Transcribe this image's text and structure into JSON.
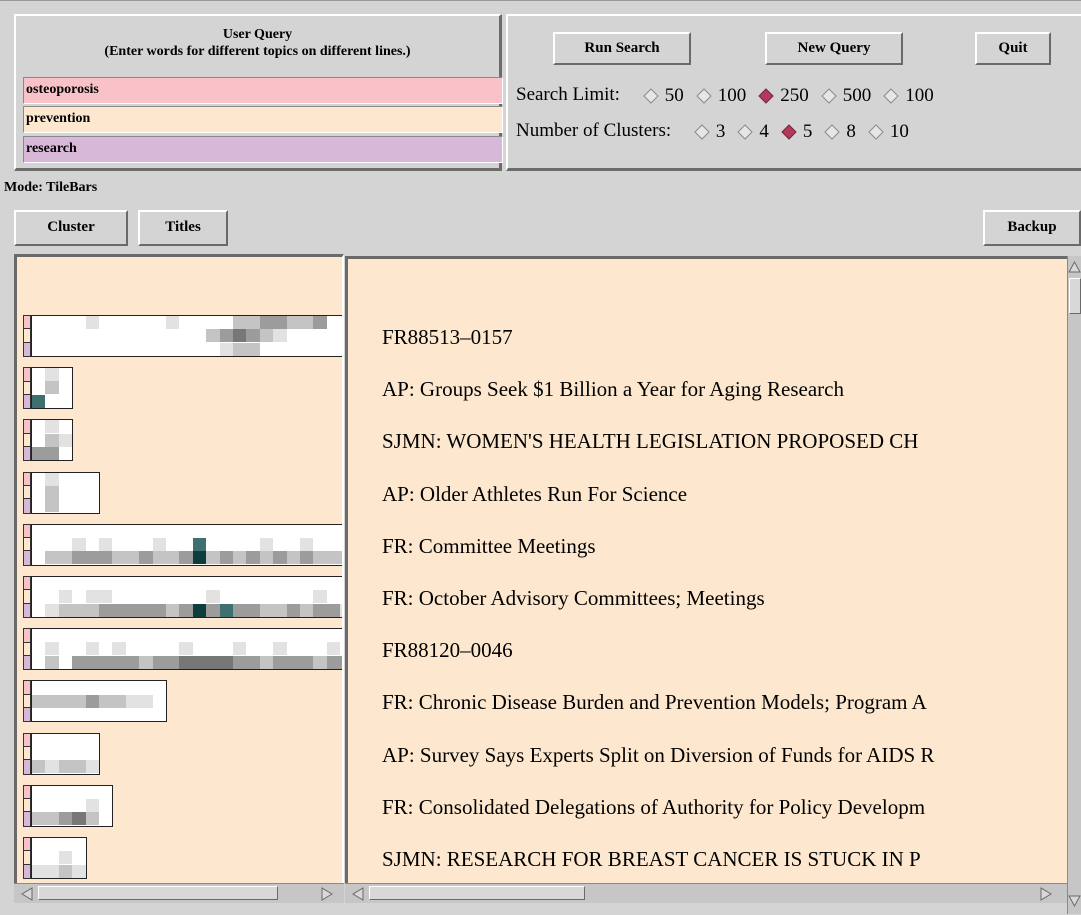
{
  "query": {
    "header_line1": "User Query",
    "header_line2": "(Enter words for different topics on different lines.)",
    "topics": [
      {
        "text": "osteoporosis",
        "color": "#f8c2c8"
      },
      {
        "text": "prevention",
        "color": "#fde8cf"
      },
      {
        "text": "research",
        "color": "#d8b8d8"
      }
    ]
  },
  "controls": {
    "run_search": "Run Search",
    "new_query": "New Query",
    "quit": "Quit",
    "search_limit_label": "Search Limit:",
    "search_limit_options": [
      "50",
      "100",
      "250",
      "500",
      "100"
    ],
    "search_limit_selected": "250",
    "clusters_label": "Number of Clusters:",
    "cluster_options": [
      "3",
      "4",
      "5",
      "8",
      "10"
    ],
    "clusters_selected": "5"
  },
  "mode": {
    "label": "Mode: TileBars"
  },
  "toolbar": {
    "cluster": "Cluster",
    "titles": "Titles",
    "backup": "Backup"
  },
  "results": [
    "FR88513–0157",
    "AP: Groups Seek $1 Billion a Year for Aging Research",
    "SJMN: WOMEN'S HEALTH LEGISLATION PROPOSED CH",
    "AP: Older Athletes Run For Science",
    "FR: Committee Meetings",
    "FR: October Advisory Committees; Meetings",
    "FR88120–0046",
    "FR: Chronic Disease Burden and Prevention Models; Program A",
    "AP: Survey Says Experts Split on Diversion of Funds for AIDS R",
    "FR: Consolidated Delegations of Authority for Policy Developm",
    "SJMN: RESEARCH FOR BREAST CANCER IS STUCK IN P"
  ],
  "tilebars": [
    {
      "segments": 24,
      "rows": [
        [
          0,
          0,
          0,
          0,
          1,
          0,
          0,
          0,
          0,
          0,
          1,
          0,
          0,
          0,
          0,
          2,
          2,
          3,
          3,
          2,
          2,
          3,
          0,
          0
        ],
        [
          0,
          0,
          0,
          0,
          0,
          0,
          0,
          0,
          0,
          0,
          0,
          0,
          0,
          2,
          3,
          4,
          3,
          2,
          1,
          0,
          0,
          0,
          0,
          0
        ],
        [
          0,
          0,
          0,
          0,
          0,
          0,
          0,
          0,
          0,
          0,
          0,
          0,
          0,
          0,
          1,
          2,
          2,
          0,
          0,
          0,
          0,
          0,
          0,
          0
        ]
      ]
    },
    {
      "segments": 3,
      "rows": [
        [
          0,
          1,
          0
        ],
        [
          0,
          2,
          0
        ],
        [
          5,
          0,
          0
        ]
      ]
    },
    {
      "segments": 3,
      "rows": [
        [
          0,
          1,
          0
        ],
        [
          0,
          2,
          1
        ],
        [
          3,
          3,
          0
        ]
      ]
    },
    {
      "segments": 5,
      "rows": [
        [
          0,
          1,
          0,
          0,
          0
        ],
        [
          0,
          2,
          0,
          0,
          0
        ],
        [
          0,
          2,
          0,
          0,
          0
        ]
      ]
    },
    {
      "segments": 24,
      "rows": [
        [
          0,
          0,
          0,
          0,
          0,
          0,
          0,
          0,
          0,
          0,
          0,
          0,
          0,
          0,
          0,
          0,
          0,
          0,
          0,
          0,
          0,
          0,
          0,
          0
        ],
        [
          0,
          0,
          0,
          1,
          0,
          1,
          0,
          0,
          0,
          1,
          0,
          0,
          5,
          0,
          0,
          0,
          0,
          1,
          0,
          0,
          1,
          0,
          0,
          0
        ],
        [
          0,
          2,
          2,
          3,
          3,
          3,
          2,
          2,
          3,
          2,
          2,
          3,
          6,
          2,
          3,
          2,
          3,
          2,
          3,
          2,
          3,
          2,
          2,
          2
        ]
      ]
    },
    {
      "segments": 24,
      "rows": [
        [
          0,
          0,
          0,
          0,
          0,
          0,
          0,
          0,
          0,
          0,
          0,
          0,
          0,
          0,
          0,
          0,
          0,
          0,
          0,
          0,
          0,
          0,
          0,
          0
        ],
        [
          0,
          0,
          1,
          0,
          1,
          1,
          0,
          0,
          0,
          0,
          0,
          0,
          0,
          1,
          0,
          0,
          0,
          0,
          0,
          0,
          0,
          1,
          0,
          0
        ],
        [
          0,
          1,
          2,
          2,
          2,
          3,
          3,
          3,
          3,
          3,
          2,
          3,
          6,
          3,
          5,
          3,
          3,
          2,
          2,
          3,
          2,
          3,
          3,
          1
        ]
      ]
    },
    {
      "segments": 24,
      "rows": [
        [
          0,
          0,
          0,
          0,
          0,
          0,
          0,
          0,
          0,
          0,
          0,
          0,
          0,
          0,
          0,
          0,
          0,
          0,
          0,
          0,
          0,
          0,
          0,
          0
        ],
        [
          0,
          1,
          0,
          0,
          1,
          0,
          1,
          0,
          0,
          0,
          0,
          1,
          0,
          0,
          0,
          1,
          0,
          0,
          1,
          0,
          0,
          0,
          1,
          0
        ],
        [
          0,
          2,
          0,
          3,
          3,
          3,
          3,
          3,
          2,
          3,
          3,
          4,
          4,
          4,
          4,
          3,
          3,
          2,
          3,
          3,
          3,
          2,
          3,
          3
        ]
      ]
    },
    {
      "segments": 10,
      "rows": [
        [
          0,
          0,
          0,
          0,
          0,
          0,
          0,
          0,
          0,
          0
        ],
        [
          2,
          2,
          2,
          2,
          3,
          2,
          2,
          1,
          1,
          0
        ],
        [
          0,
          0,
          0,
          0,
          0,
          0,
          0,
          0,
          0,
          0
        ]
      ]
    },
    {
      "segments": 5,
      "rows": [
        [
          0,
          0,
          0,
          0,
          0
        ],
        [
          0,
          0,
          0,
          0,
          0
        ],
        [
          2,
          1,
          2,
          2,
          1
        ]
      ]
    },
    {
      "segments": 6,
      "rows": [
        [
          0,
          0,
          0,
          0,
          0,
          0
        ],
        [
          0,
          0,
          0,
          0,
          1,
          0
        ],
        [
          2,
          2,
          3,
          4,
          2,
          0
        ]
      ]
    },
    {
      "segments": 4,
      "rows": [
        [
          0,
          0,
          0,
          0
        ],
        [
          0,
          0,
          1,
          0
        ],
        [
          1,
          1,
          2,
          1
        ]
      ]
    }
  ]
}
